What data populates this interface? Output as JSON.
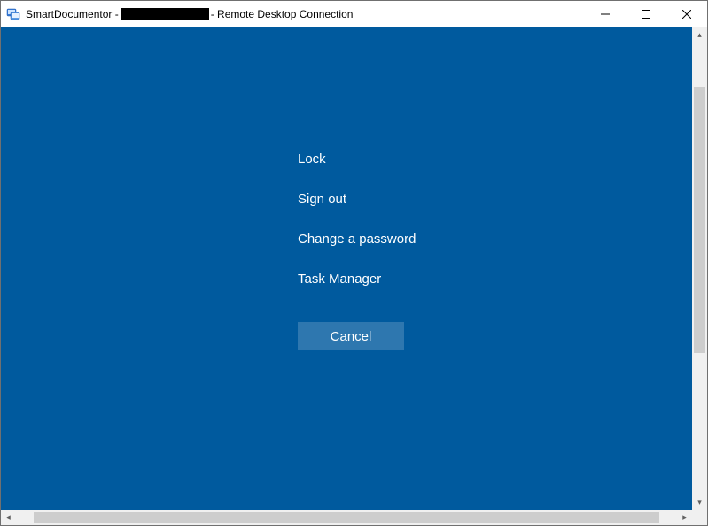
{
  "titlebar": {
    "icon_name": "rdp-icon",
    "prefix": "SmartDocumentor - ",
    "suffix": " - Remote Desktop Connection"
  },
  "menu": {
    "lock": "Lock",
    "signout": "Sign out",
    "changepw": "Change a password",
    "taskmgr": "Task Manager",
    "cancel": "Cancel"
  }
}
